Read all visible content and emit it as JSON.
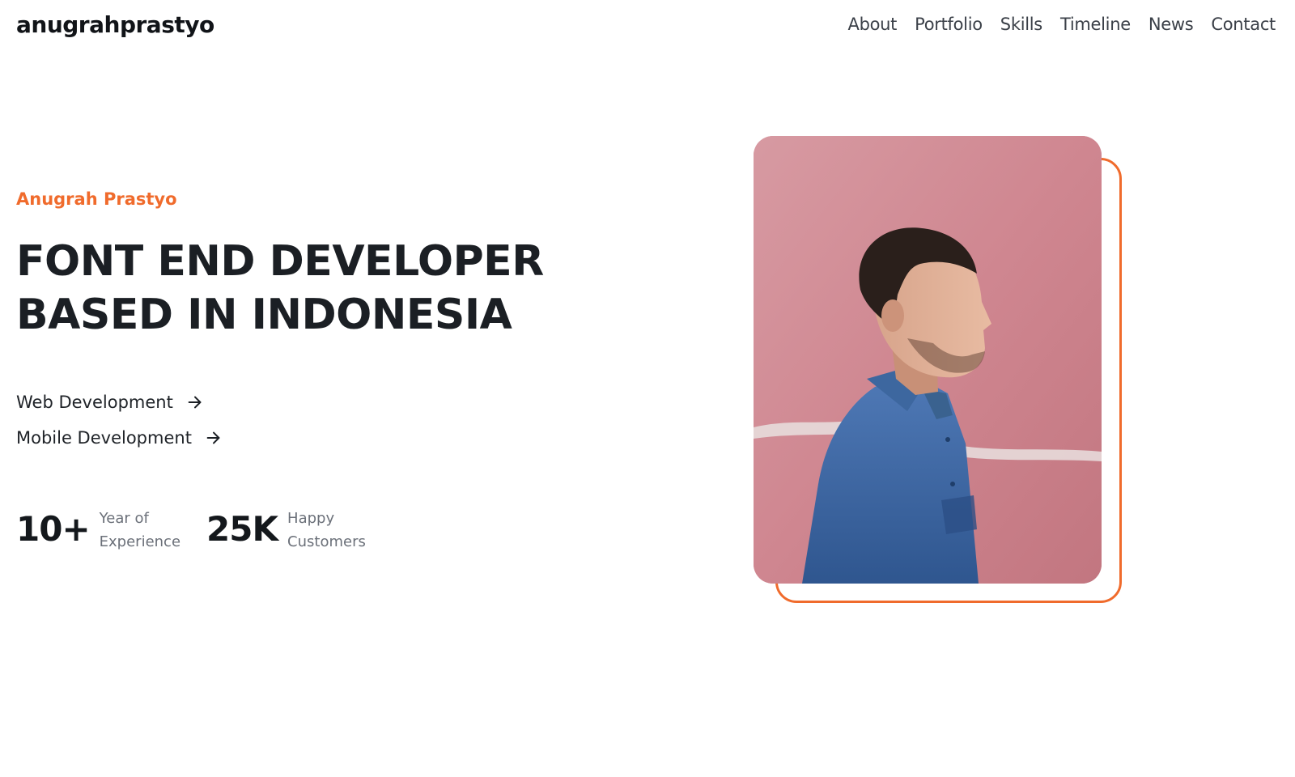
{
  "header": {
    "logo": "anugrahprastyo",
    "nav": [
      "About",
      "Portfolio",
      "Skills",
      "Timeline",
      "News",
      "Contact"
    ]
  },
  "hero": {
    "subtitle": "Anugrah Prastyo",
    "headline_line1": "FONT END DEVELOPER",
    "headline_line2": "BASED IN INDONESIA",
    "services": [
      {
        "label": "Web Development",
        "icon": "arrow-right-icon"
      },
      {
        "label": "Mobile Development",
        "icon": "arrow-right-icon"
      }
    ],
    "stats": [
      {
        "value": "10+",
        "label_line1": "Year of",
        "label_line2": "Experience"
      },
      {
        "value": "25K",
        "label_line1": "Happy",
        "label_line2": "Customers"
      }
    ]
  },
  "colors": {
    "accent": "#f06b2c",
    "text_dark": "#1b1f24",
    "text_muted": "#6b7079"
  }
}
